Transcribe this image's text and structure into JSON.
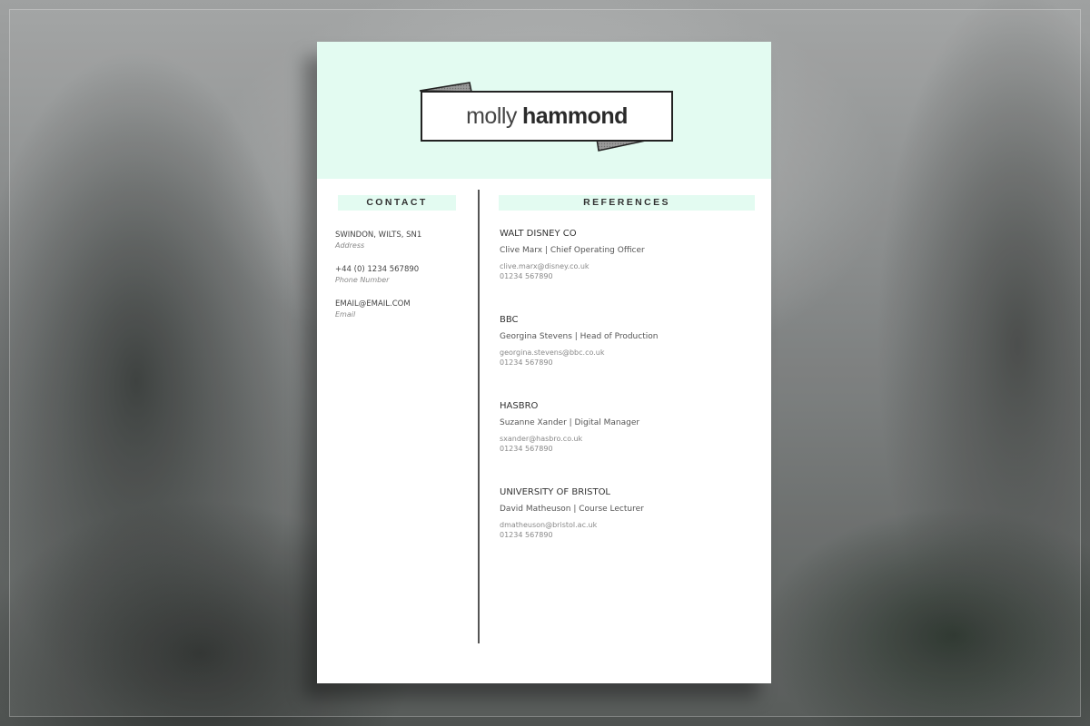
{
  "resume": {
    "name_first": "molly",
    "name_last": "hammond",
    "contact_heading": "CONTACT",
    "references_heading": "REFERENCES",
    "contact": [
      {
        "value": "SWINDON, WILTS, SN1",
        "caption": "Address"
      },
      {
        "value": "+44 (0) 1234 567890",
        "caption": "Phone Number"
      },
      {
        "value": "EMAIL@EMAIL.COM",
        "caption": "Email"
      }
    ],
    "references": [
      {
        "org": "WALT DISNEY CO",
        "person": "Clive Marx | Chief Operating Officer",
        "email": "clive.marx@disney.co.uk",
        "phone": "01234 567890"
      },
      {
        "org": "BBC",
        "person": "Georgina Stevens | Head of Production",
        "email": "georgina.stevens@bbc.co.uk",
        "phone": "01234 567890"
      },
      {
        "org": "HASBRO",
        "person": "Suzanne Xander | Digital Manager",
        "email": "sxander@hasbro.co.uk",
        "phone": "01234 567890"
      },
      {
        "org": "UNIVERSITY OF BRISTOL",
        "person": "David Matheuson | Course Lecturer",
        "email": "dmatheuson@bristol.ac.uk",
        "phone": "01234 567890"
      }
    ]
  },
  "colors": {
    "accent": "#e3fbf1",
    "text": "#333333",
    "muted": "#888888"
  }
}
